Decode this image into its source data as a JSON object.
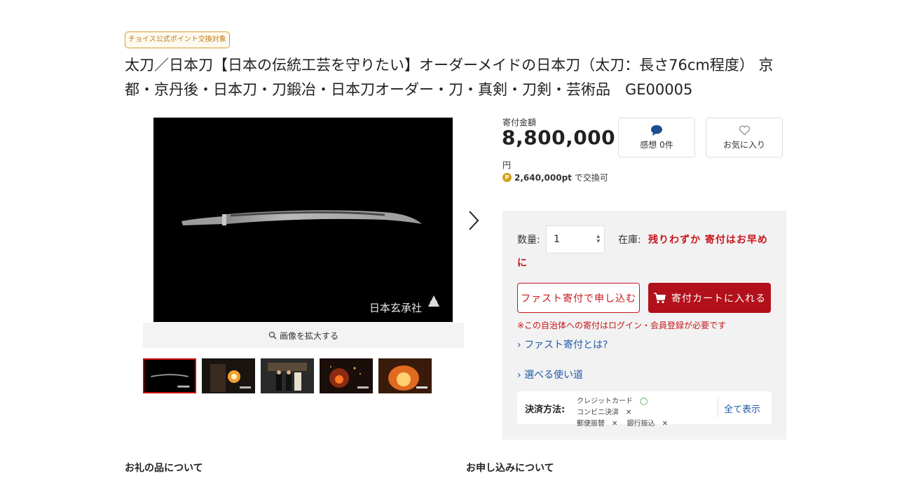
{
  "badge": "チョイス公式ポイント交換対象",
  "title": "太刀／日本刀【日本の伝統工芸を守りたい】オーダーメイドの日本刀（太刀：長さ76cm程度） 京都・京丹後・日本刀・刀鍛冶・日本刀オーダー・刀・真剣・刀剣・芸術品　GE00005",
  "gallery": {
    "zoom_label": "画像を拡大する",
    "watermark": "日本玄承社",
    "thumbnail_count": 5
  },
  "price": {
    "label": "寄付金額",
    "amount": "8,800,000",
    "unit": "円",
    "points_value": "2,640,000pt",
    "points_suffix": "で交換可",
    "points_icon": "P"
  },
  "actions": {
    "comments_label": "感想 0件",
    "favorite_label": "お気に入り"
  },
  "panel": {
    "quantity_label": "数量:",
    "quantity_value": "1",
    "stock_label": "在庫:",
    "stock_value_line1": "残りわずか 寄付はお早め",
    "stock_value_line2": "に",
    "fast_button": "ファスト寄付で申し込む",
    "cart_button": "寄付カートに入れる",
    "login_notice": "※この自治体への寄付はログイン・会員登録が必要です",
    "fast_link": "ファスト寄付とは?",
    "uses_link": "選べる使い道",
    "payment_label": "決済方法:",
    "payment_methods": [
      {
        "name": "クレジットカード",
        "mark": "◯"
      },
      {
        "name": "コンビニ決済",
        "mark": "✕"
      },
      {
        "name": "郵便振替",
        "mark": "✕"
      },
      {
        "name": "銀行振込",
        "mark": "✕"
      }
    ],
    "show_all": "全て表示"
  },
  "sections": {
    "left": "お礼の品について",
    "right": "お申し込みについて"
  },
  "colors": {
    "accent_red": "#c8161d",
    "cart_red": "#b2101a",
    "link_blue": "#1e5aa8",
    "badge_gold": "#d99a2b",
    "panel_bg": "#f2f2f2"
  }
}
